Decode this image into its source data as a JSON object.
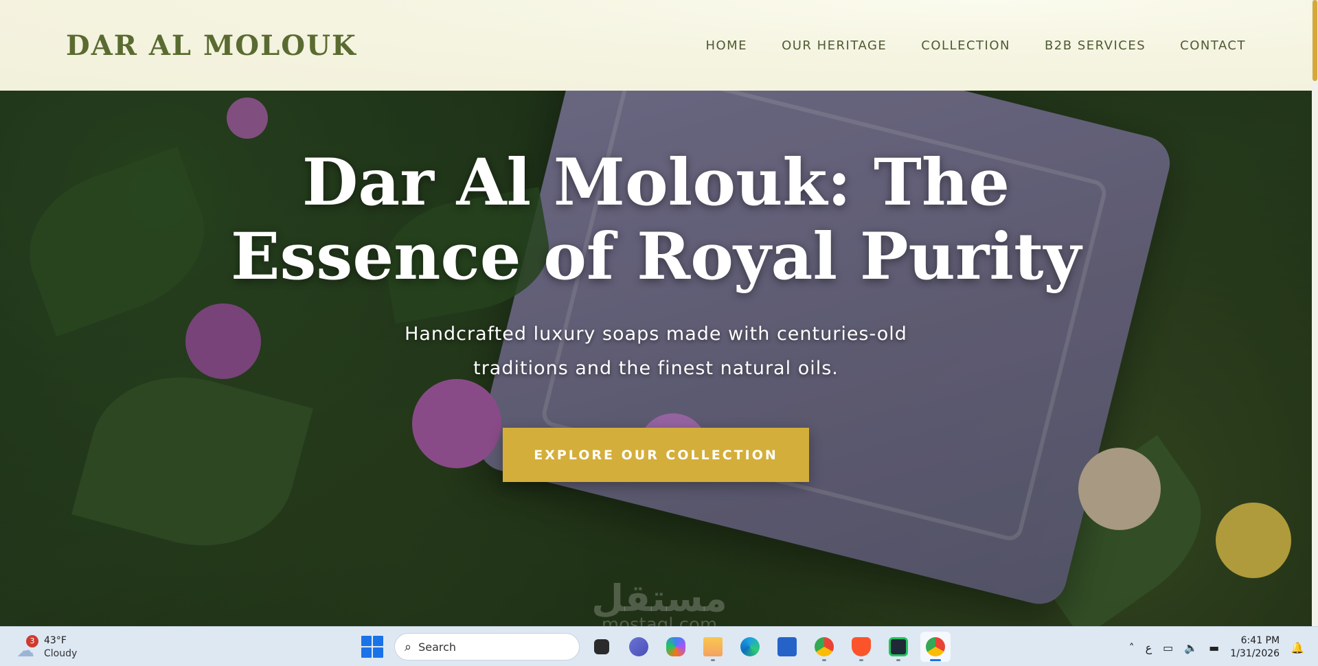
{
  "header": {
    "logo": "DAR AL MOLOUK",
    "nav": [
      "HOME",
      "OUR HERITAGE",
      "COLLECTION",
      "B2B SERVICES",
      "CONTACT"
    ]
  },
  "hero": {
    "title": "Dar Al Molouk: The Essence of Royal Purity",
    "subtitle": "Handcrafted luxury soaps made with centuries-old traditions and the finest natural oils.",
    "cta": "EXPLORE OUR COLLECTION"
  },
  "watermark": {
    "arabic": "مستقل",
    "latin": "mostaql.com"
  },
  "taskbar": {
    "weather": {
      "badge": "3",
      "temp": "43°F",
      "condition": "Cloudy"
    },
    "search_placeholder": "Search",
    "apps": [
      "file-explorer-dark",
      "teams",
      "copilot",
      "file-explorer",
      "edge",
      "microsoft-store",
      "chrome",
      "brave",
      "terminal-app",
      "chrome-active"
    ],
    "tray": {
      "language": "ع"
    },
    "clock": {
      "time": "6:41 PM",
      "date": "1/31/2026"
    }
  },
  "colors": {
    "brand_green": "#5a6b31",
    "header_bg": "#f4f3df",
    "cta_gold": "#d4ae3a",
    "scroll_thumb": "#d4a93a"
  }
}
